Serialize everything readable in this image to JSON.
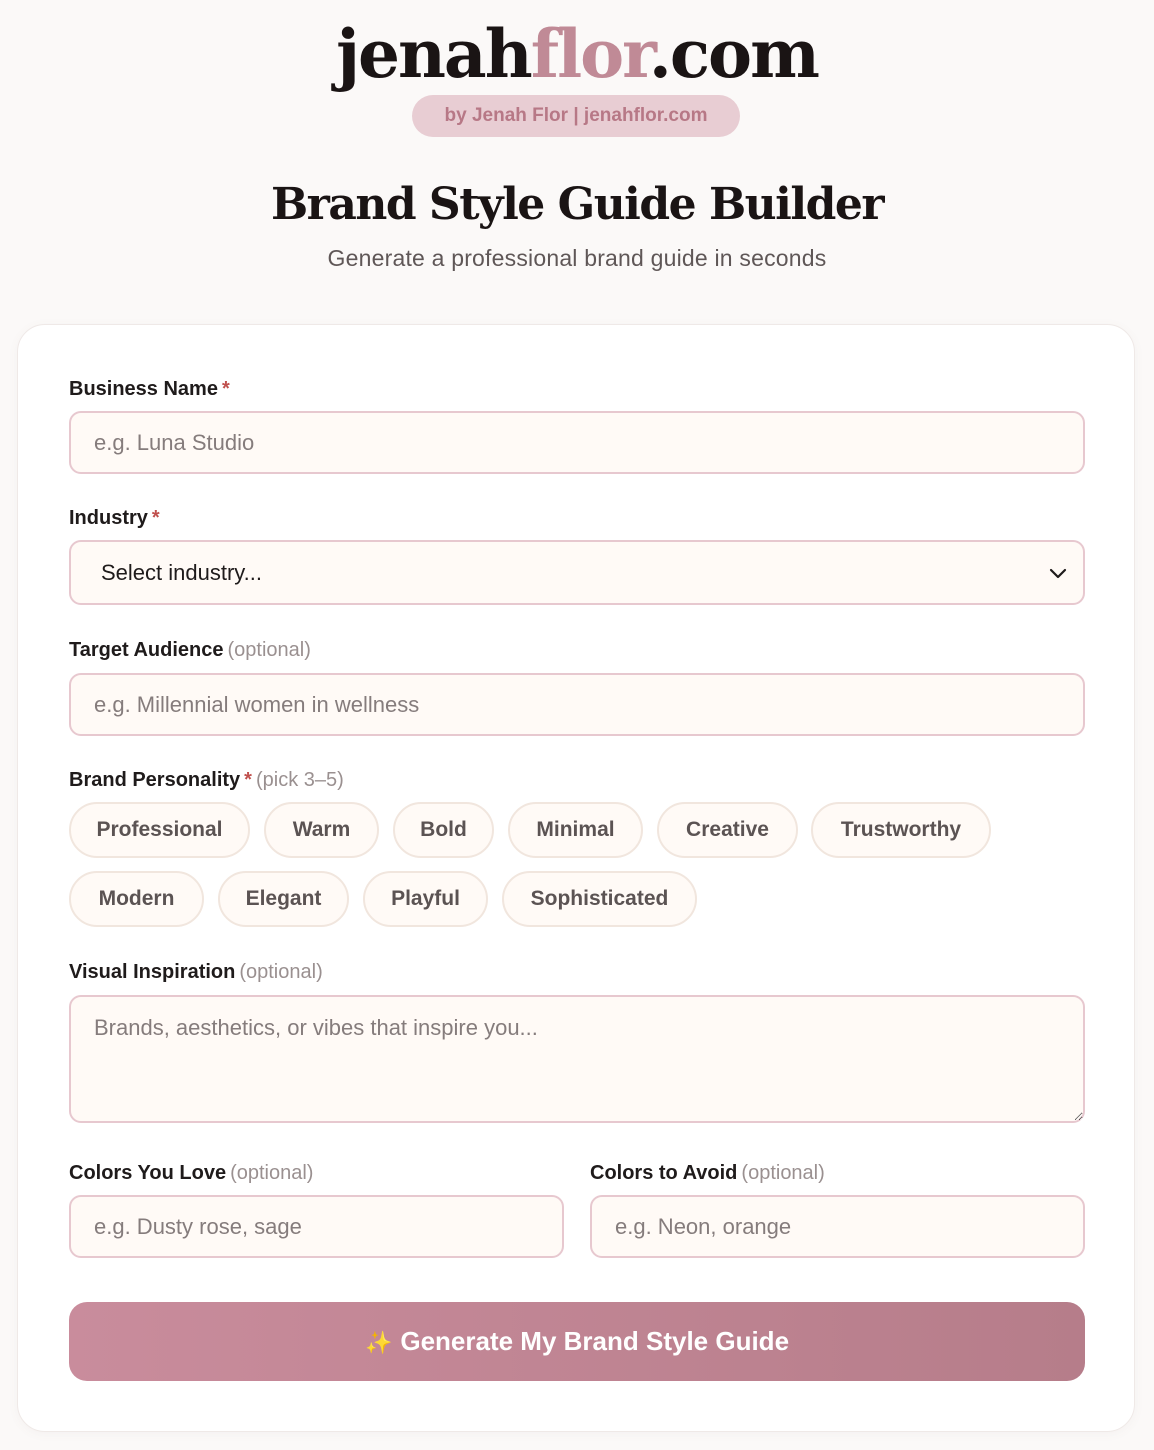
{
  "header": {
    "logo_main": "jenah",
    "logo_accent": "flor",
    "logo_tld": ".com",
    "byline": "by Jenah Flor | jenahflor.com",
    "title": "Brand Style Guide Builder",
    "subtitle": "Generate a professional brand guide in seconds"
  },
  "form": {
    "business_name": {
      "label": "Business Name",
      "required": "*",
      "placeholder": "e.g. Luna Studio"
    },
    "industry": {
      "label": "Industry",
      "required": "*",
      "selected": "Select industry..."
    },
    "target_audience": {
      "label": "Target Audience",
      "optional": "(optional)",
      "placeholder": "e.g. Millennial women in wellness"
    },
    "brand_personality": {
      "label": "Brand Personality",
      "required": "*",
      "hint": "(pick 3–5)",
      "options": [
        "Professional",
        "Warm",
        "Bold",
        "Minimal",
        "Creative",
        "Trustworthy",
        "Modern",
        "Elegant",
        "Playful",
        "Sophisticated"
      ]
    },
    "visual_inspiration": {
      "label": "Visual Inspiration",
      "optional": "(optional)",
      "placeholder": "Brands, aesthetics, or vibes that inspire you..."
    },
    "colors_love": {
      "label": "Colors You Love",
      "optional": "(optional)",
      "placeholder": "e.g. Dusty rose, sage"
    },
    "colors_avoid": {
      "label": "Colors to Avoid",
      "optional": "(optional)",
      "placeholder": "e.g. Neon, orange"
    },
    "submit": {
      "icon": "sparkles-icon",
      "label": "Generate My Brand Style Guide"
    }
  },
  "colors": {
    "accent": "#c08a96",
    "button_start": "#c98c9c",
    "button_end": "#b67d8a",
    "field_border": "#e7c8cf",
    "field_bg": "#fffaf6"
  }
}
